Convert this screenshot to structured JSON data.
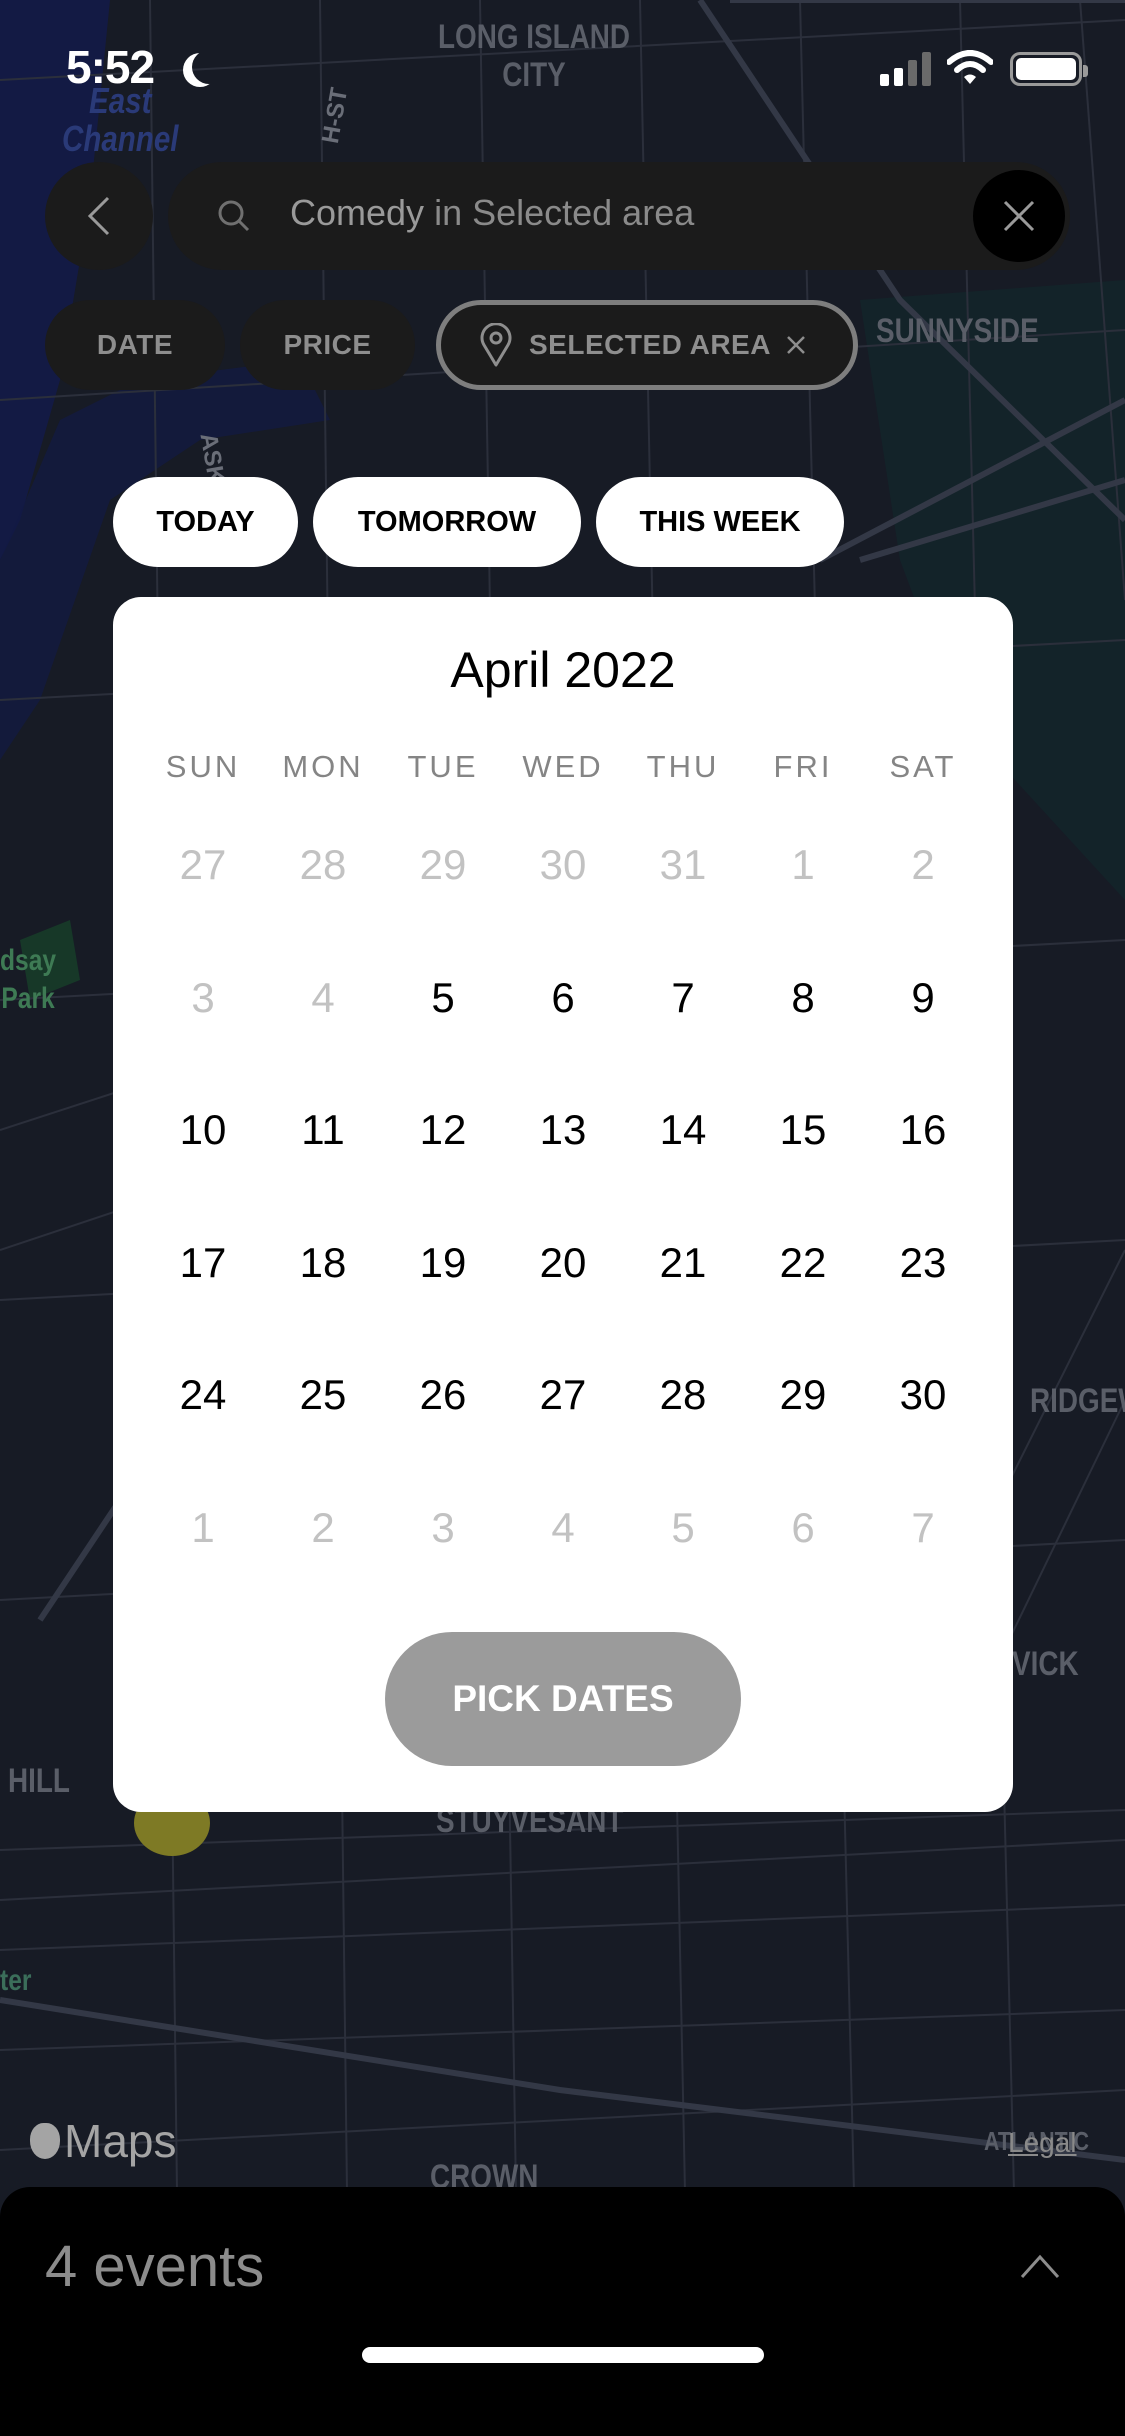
{
  "status_bar": {
    "time": "5:52",
    "focus_icon": "moon-icon",
    "signal_icon": "cellular-signal-icon",
    "wifi_icon": "wifi-icon",
    "battery_icon": "battery-icon"
  },
  "map": {
    "labels": {
      "long_island_city": "LONG ISLAND\nCITY",
      "east_channel": "East\nChannel",
      "street_st": "H-ST",
      "pulaski": "ASKI-B",
      "sunnyside": "SUNNYSIDE",
      "lindsay_park": "dsay\nPark",
      "ridgewood": "RIDGEW",
      "bushwick": "VICK",
      "hill": "HILL",
      "stuyvesant": "STUYVESANT",
      "center": "ter",
      "crown": "CROWN",
      "atlantic": "ATLANTIC"
    },
    "attribution": "Maps",
    "legal": "Legal"
  },
  "search": {
    "query": "Comedy",
    "context": " in Selected area",
    "back_icon": "chevron-left-icon",
    "search_icon": "search-icon",
    "clear_icon": "close-icon"
  },
  "filters": {
    "date": "DATE",
    "price": "PRICE",
    "area": "SELECTED AREA"
  },
  "quick_dates": {
    "today": "TODAY",
    "tomorrow": "TOMORROW",
    "this_week": "THIS WEEK"
  },
  "calendar": {
    "title": "April 2022",
    "weekdays": [
      "SUN",
      "MON",
      "TUE",
      "WED",
      "THU",
      "FRI",
      "SAT"
    ],
    "days": [
      {
        "d": "27",
        "muted": true
      },
      {
        "d": "28",
        "muted": true
      },
      {
        "d": "29",
        "muted": true
      },
      {
        "d": "30",
        "muted": true
      },
      {
        "d": "31",
        "muted": true
      },
      {
        "d": "1",
        "muted": true
      },
      {
        "d": "2",
        "muted": true
      },
      {
        "d": "3",
        "muted": true
      },
      {
        "d": "4",
        "muted": true
      },
      {
        "d": "5",
        "muted": false
      },
      {
        "d": "6",
        "muted": false
      },
      {
        "d": "7",
        "muted": false
      },
      {
        "d": "8",
        "muted": false
      },
      {
        "d": "9",
        "muted": false
      },
      {
        "d": "10",
        "muted": false
      },
      {
        "d": "11",
        "muted": false
      },
      {
        "d": "12",
        "muted": false
      },
      {
        "d": "13",
        "muted": false
      },
      {
        "d": "14",
        "muted": false
      },
      {
        "d": "15",
        "muted": false
      },
      {
        "d": "16",
        "muted": false
      },
      {
        "d": "17",
        "muted": false
      },
      {
        "d": "18",
        "muted": false
      },
      {
        "d": "19",
        "muted": false
      },
      {
        "d": "20",
        "muted": false
      },
      {
        "d": "21",
        "muted": false
      },
      {
        "d": "22",
        "muted": false
      },
      {
        "d": "23",
        "muted": false
      },
      {
        "d": "24",
        "muted": false
      },
      {
        "d": "25",
        "muted": false
      },
      {
        "d": "26",
        "muted": false
      },
      {
        "d": "27",
        "muted": false
      },
      {
        "d": "28",
        "muted": false
      },
      {
        "d": "29",
        "muted": false
      },
      {
        "d": "30",
        "muted": false
      },
      {
        "d": "1",
        "muted": true
      },
      {
        "d": "2",
        "muted": true
      },
      {
        "d": "3",
        "muted": true
      },
      {
        "d": "4",
        "muted": true
      },
      {
        "d": "5",
        "muted": true
      },
      {
        "d": "6",
        "muted": true
      },
      {
        "d": "7",
        "muted": true
      }
    ],
    "pick_button": "PICK DATES"
  },
  "sheet": {
    "events_count": "4 events",
    "expand_icon": "chevron-up-icon"
  },
  "colors": {
    "map_bg": "#171b25",
    "control_bg": "#1b1b1b",
    "selected_chip_border": "#7e7e7e",
    "pick_button_bg": "#9b9b9b",
    "muted_day": "#c2c2c2",
    "map_pin": "#7e7a25"
  }
}
